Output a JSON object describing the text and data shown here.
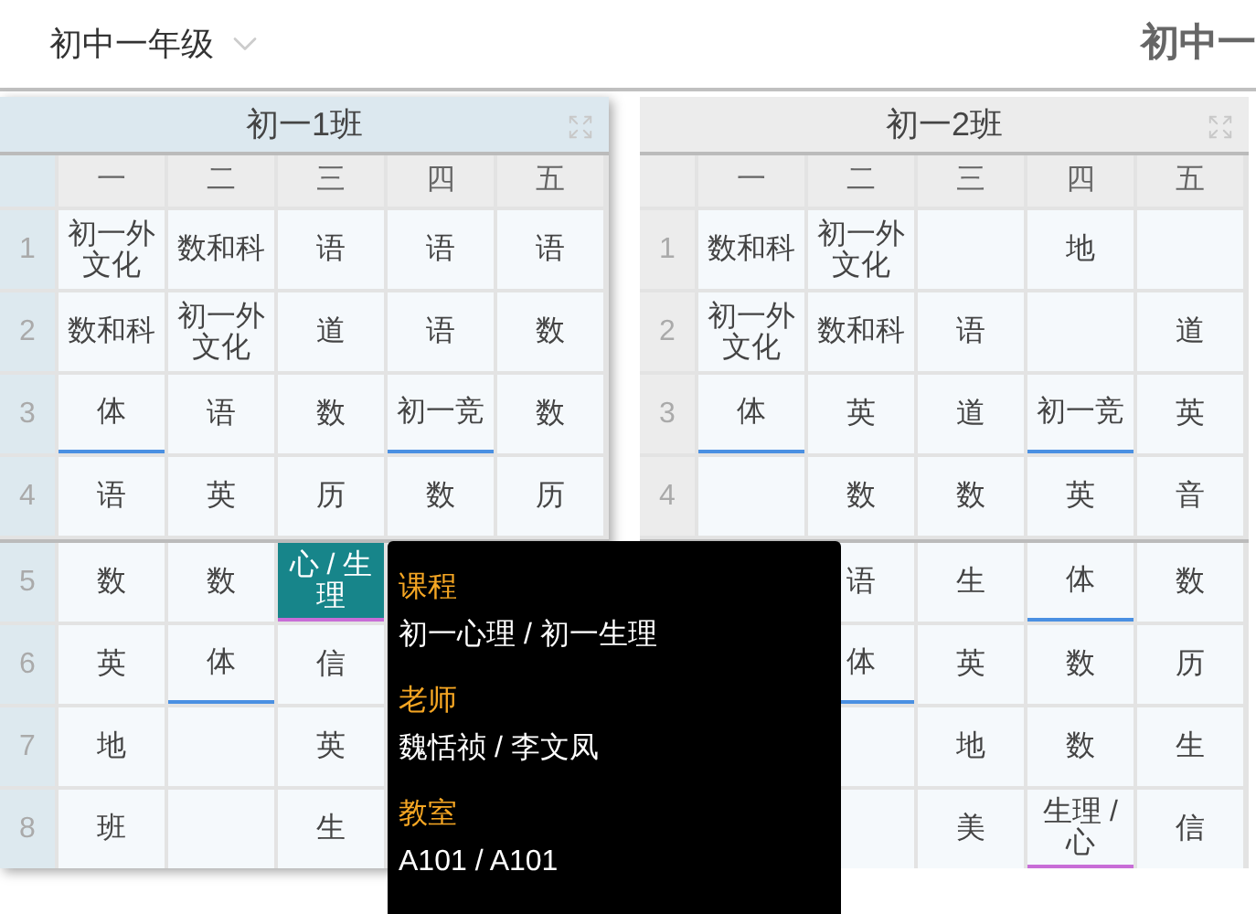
{
  "grade_selector": {
    "value": "初中一年级"
  },
  "page_title": "初中一",
  "classes": [
    {
      "title": "初一1班",
      "selected": true,
      "days": [
        "一",
        "二",
        "三",
        "四",
        "五"
      ],
      "rows": [
        {
          "label": "1",
          "cells": [
            {
              "text": "初一外文化",
              "selected": false
            },
            {
              "text": "数和科",
              "selected": false
            },
            {
              "text": "语",
              "selected": false
            },
            {
              "text": "语",
              "selected": false
            },
            {
              "text": "语",
              "selected": false
            }
          ]
        },
        {
          "label": "2",
          "cells": [
            {
              "text": "数和科",
              "selected": false
            },
            {
              "text": "初一外文化",
              "selected": false
            },
            {
              "text": "道",
              "selected": false
            },
            {
              "text": "语",
              "selected": false
            },
            {
              "text": "数",
              "selected": false
            }
          ]
        },
        {
          "label": "3",
          "cells": [
            {
              "text": "体",
              "selected": false,
              "color": "#4a90e2"
            },
            {
              "text": "语",
              "selected": false
            },
            {
              "text": "数",
              "selected": false
            },
            {
              "text": "初一竞",
              "selected": false,
              "color": "#4a90e2"
            },
            {
              "text": "数",
              "selected": false
            }
          ]
        },
        {
          "label": "4",
          "cells": [
            {
              "text": "语",
              "selected": false
            },
            {
              "text": "英",
              "selected": false
            },
            {
              "text": "历",
              "selected": false
            },
            {
              "text": "数",
              "selected": false
            },
            {
              "text": "历",
              "selected": false
            }
          ]
        },
        {
          "label": "5",
          "cells": [
            {
              "text": "数",
              "selected": false
            },
            {
              "text": "数",
              "selected": false
            },
            {
              "text": "心 / 生理",
              "selected": true,
              "color": "#c86dd7"
            },
            null,
            null
          ]
        },
        {
          "label": "6",
          "cells": [
            {
              "text": "英",
              "selected": false
            },
            {
              "text": "体",
              "selected": false,
              "color": "#4a90e2"
            },
            {
              "text": "信",
              "selected": false
            },
            null,
            null
          ]
        },
        {
          "label": "7",
          "cells": [
            {
              "text": "地",
              "selected": false
            },
            {
              "selected": false
            },
            {
              "text": "英",
              "selected": false
            },
            null,
            null
          ]
        },
        {
          "label": "8",
          "cells": [
            {
              "text": "班",
              "selected": false
            },
            {
              "selected": false
            },
            {
              "text": "生",
              "selected": false
            },
            null,
            null
          ]
        }
      ]
    },
    {
      "title": "初一2班",
      "selected": false,
      "days": [
        "一",
        "二",
        "三",
        "四",
        "五"
      ],
      "rows": [
        {
          "label": "1",
          "cells": [
            {
              "text": "数和科",
              "selected": false
            },
            {
              "text": "初一外文化",
              "selected": false
            },
            {
              "selected": false
            },
            {
              "text": "地",
              "selected": false
            },
            {
              "selected": false
            }
          ]
        },
        {
          "label": "2",
          "cells": [
            {
              "text": "初一外文化",
              "selected": false
            },
            {
              "text": "数和科",
              "selected": false
            },
            {
              "text": "语",
              "selected": false
            },
            {
              "selected": false
            },
            {
              "text": "道",
              "selected": false
            }
          ]
        },
        {
          "label": "3",
          "cells": [
            {
              "text": "体",
              "selected": false,
              "color": "#4a90e2"
            },
            {
              "text": "英",
              "selected": false
            },
            {
              "text": "道",
              "selected": false
            },
            {
              "text": "初一竞",
              "selected": false,
              "color": "#4a90e2"
            },
            {
              "text": "英",
              "selected": false
            }
          ]
        },
        {
          "label": "4",
          "cells": [
            {
              "selected": false
            },
            {
              "text": "数",
              "selected": false
            },
            {
              "text": "数",
              "selected": false
            },
            {
              "text": "英",
              "selected": false
            },
            {
              "text": "音",
              "selected": false
            }
          ]
        },
        {
          "cells": [
            null,
            {
              "text": "语",
              "selected": false
            },
            {
              "text": "生",
              "selected": false
            },
            {
              "text": "体",
              "selected": false,
              "color": "#4a90e2"
            },
            {
              "text": "数",
              "selected": false
            }
          ]
        },
        {
          "cells": [
            null,
            {
              "text": "体",
              "selected": false,
              "color": "#4a90e2"
            },
            {
              "text": "英",
              "selected": false
            },
            {
              "text": "数",
              "selected": false
            },
            {
              "text": "历",
              "selected": false
            }
          ]
        },
        {
          "cells": [
            null,
            {
              "selected": false
            },
            {
              "text": "地",
              "selected": false
            },
            {
              "text": "数",
              "selected": false
            },
            {
              "text": "生",
              "selected": false
            }
          ]
        },
        {
          "cells": [
            null,
            {
              "selected": false
            },
            {
              "text": "美",
              "selected": false
            },
            {
              "text": "生理 / 心",
              "selected": false,
              "color": "#c86dd7"
            },
            {
              "text": "信",
              "selected": false
            }
          ]
        }
      ]
    }
  ],
  "tooltip": {
    "items": [
      {
        "label": "课程",
        "value": "初一心理 / 初一生理"
      },
      {
        "label": "老师",
        "value": "魏恬祯 / 李文凤"
      },
      {
        "label": "教室",
        "value": "A101 / A101"
      }
    ]
  }
}
